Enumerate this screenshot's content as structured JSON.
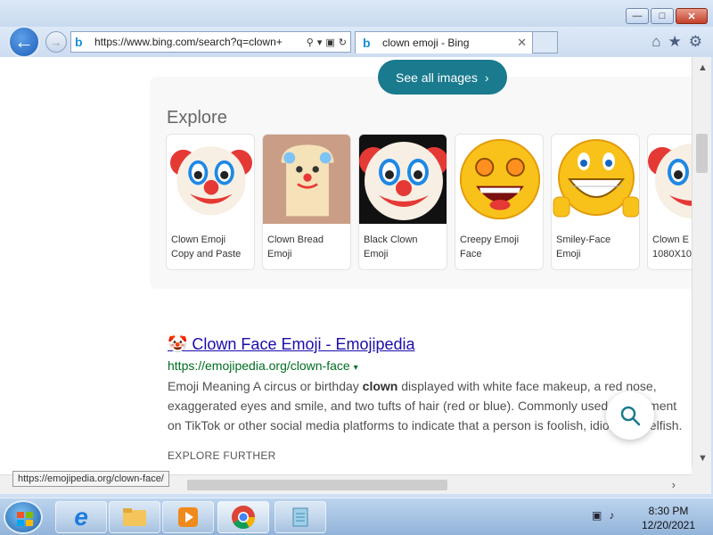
{
  "browser": {
    "address": "https://www.bing.com/search?q=clown+",
    "tab_title": "clown emoji - Bing",
    "status_url": "https://emojipedia.org/clown-face/"
  },
  "explore": {
    "see_all_label": "See all images",
    "title": "Explore",
    "tiles": [
      {
        "caption": "Clown Emoji Copy and Paste"
      },
      {
        "caption": "Clown Bread Emoji"
      },
      {
        "caption": "Black Clown Emoji"
      },
      {
        "caption": "Creepy Emoji Face"
      },
      {
        "caption": "Smiley-Face Emoji"
      },
      {
        "caption": "Clown E 1080X10"
      }
    ]
  },
  "result": {
    "title": "🤡 Clown Face Emoji - Emojipedia",
    "url": "https://emojipedia.org/clown-face",
    "snippet_before": "Emoji Meaning A circus or birthday ",
    "snippet_bold": "clown",
    "snippet_after": " displayed with white face makeup, a red nose, exaggerated eyes and smile, and two tufts of hair (red or blue). Commonly used to comment on TikTok or other social media platforms to indicate that a person is foolish, idiotic, or selfish.",
    "explore_further": "EXPLORE FURTHER"
  },
  "taskbar": {
    "time": "8:30 PM",
    "date": "12/20/2021"
  }
}
